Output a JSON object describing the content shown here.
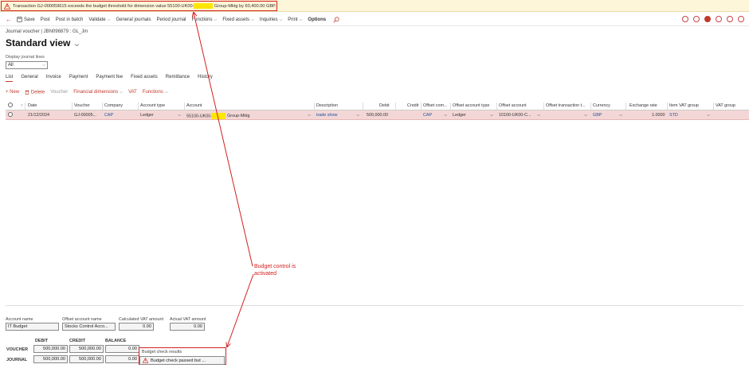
{
  "warning": {
    "text_pre": "Transaction GJ-000059615 exceeds the budget threshold for dimension value 55100-UK00-",
    "text_post": " Group-Mktg by 60,400.00 GBP."
  },
  "actionpane": {
    "back": "←",
    "items": [
      "Save",
      "Post",
      "Post in batch",
      "Validate",
      "General journals",
      "Period journal",
      "Functions",
      "Fixed assets",
      "Inquiries",
      "Print",
      "Options"
    ]
  },
  "header": {
    "breadcrumb": "Journal voucher  |  JBN096879 : GL_Jm",
    "title": "Standard view",
    "display_label": "Display journal lines",
    "display_value": "All"
  },
  "tabs": [
    "List",
    "General",
    "Invoice",
    "Payment",
    "Payment fee",
    "Fixed assets",
    "Remittance",
    "History"
  ],
  "grid_toolbar": {
    "new": "+ New",
    "delete": "Delete",
    "voucher": "Voucher",
    "fin_dims": "Financial dimensions",
    "vat": "VAT",
    "functions": "Functions"
  },
  "grid": {
    "columns": [
      "Date",
      "Voucher",
      "Company",
      "Account type",
      "Account",
      "Description",
      "Debit",
      "Credit",
      "Offset com...",
      "Offset account type",
      "Offset account",
      "Offset transaction t...",
      "Currency",
      "Exchange rate",
      "Item VAT group",
      "VAT group"
    ],
    "row": {
      "date": "21/12/2024",
      "voucher": "GJ-00005...",
      "company": "CAP",
      "account_type": "Ledger",
      "account_pre": "55100-UK00-",
      "account_post": "Group-Mktg",
      "description": "trade show",
      "debit": "500,000.00",
      "credit": "",
      "offset_company": "CAP",
      "offset_account_type": "Ledger",
      "offset_account": "10100-UK00-C...",
      "currency": "GBP",
      "exchange_rate": "1.0000",
      "item_vat_group": "STD"
    }
  },
  "annotation": "Budget control is activated",
  "footer": {
    "account_name_label": "Account name",
    "account_name_value": "IT Budget",
    "offset_account_name_label": "Offset account name",
    "offset_account_name_value": "Stocks Control Acco...",
    "calc_vat_label": "Calculated VAT amount",
    "calc_vat_value": "0.00",
    "actual_vat_label": "Actual VAT amount",
    "actual_vat_value": "0.00",
    "summary_headers": [
      "DEBIT",
      "CREDIT",
      "BALANCE"
    ],
    "voucher_label": "VOUCHER",
    "journal_label": "JOURNAL",
    "voucher_debit": "500,000.00",
    "voucher_credit": "500,000.00",
    "voucher_balance": "0.00",
    "journal_debit": "500,000.00",
    "journal_credit": "500,000.00",
    "journal_balance": "0.00",
    "budget_check_label": "Budget check results",
    "budget_check_value": "Budget check passed but ..."
  },
  "colors": {
    "accent": "#c0392b",
    "annotation": "#d32020",
    "highlight": "#ffe600",
    "selected_row": "#f3d7d6"
  }
}
